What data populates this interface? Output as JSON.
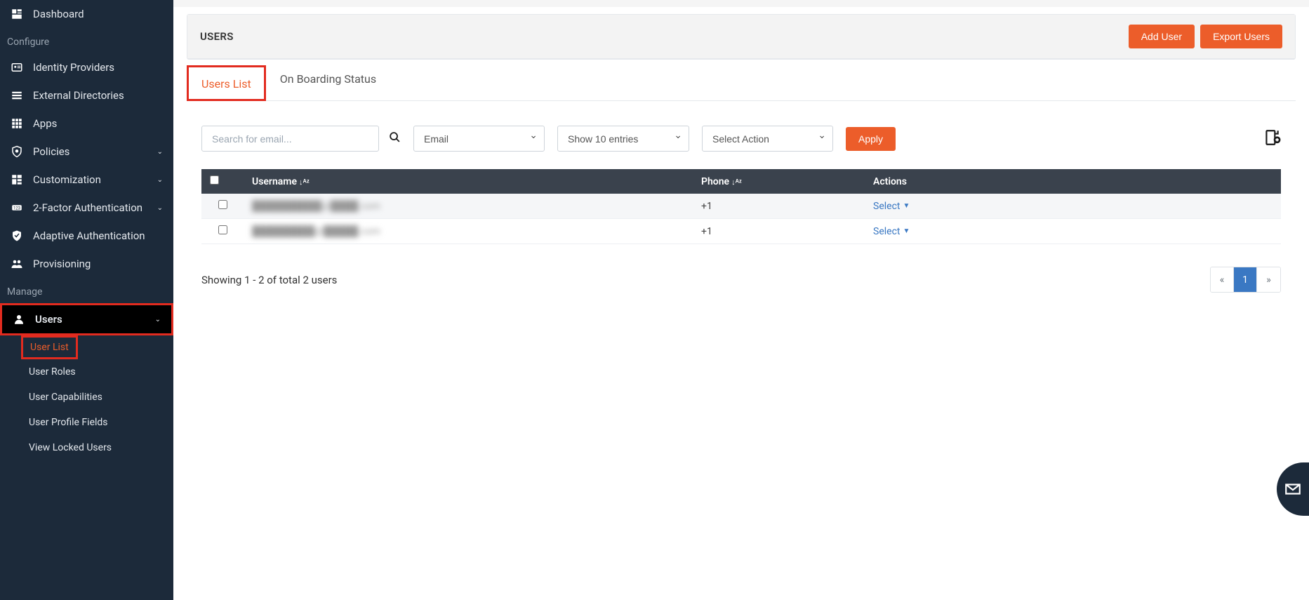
{
  "sidebar": {
    "items": [
      {
        "label": "Dashboard"
      },
      {
        "label": "Identity Providers"
      },
      {
        "label": "External Directories"
      },
      {
        "label": "Apps"
      },
      {
        "label": "Policies"
      },
      {
        "label": "Customization"
      },
      {
        "label": "2-Factor Authentication"
      },
      {
        "label": "Adaptive Authentication"
      },
      {
        "label": "Provisioning"
      },
      {
        "label": "Users"
      }
    ],
    "sections": {
      "configure": "Configure",
      "manage": "Manage"
    },
    "usersSub": [
      {
        "label": "User List"
      },
      {
        "label": "User Roles"
      },
      {
        "label": "User Capabilities"
      },
      {
        "label": "User Profile Fields"
      },
      {
        "label": "View Locked Users"
      }
    ]
  },
  "header": {
    "title": "USERS",
    "addUser": "Add User",
    "exportUsers": "Export Users"
  },
  "tabs": {
    "usersList": "Users List",
    "onboarding": "On Boarding Status"
  },
  "controls": {
    "searchPlaceholder": "Search for email...",
    "filterField": "Email",
    "entries": "Show 10 entries",
    "action": "Select Action",
    "apply": "Apply"
  },
  "table": {
    "cols": {
      "username": "Username",
      "phone": "Phone",
      "actions": "Actions"
    },
    "rows": [
      {
        "username": "██████████@████.com",
        "phone": "+1",
        "action": "Select"
      },
      {
        "username": "█████████@█████.com",
        "phone": "+1",
        "action": "Select"
      }
    ]
  },
  "footer": {
    "showing": "Showing 1 - 2 of total 2 users",
    "page": "1"
  }
}
